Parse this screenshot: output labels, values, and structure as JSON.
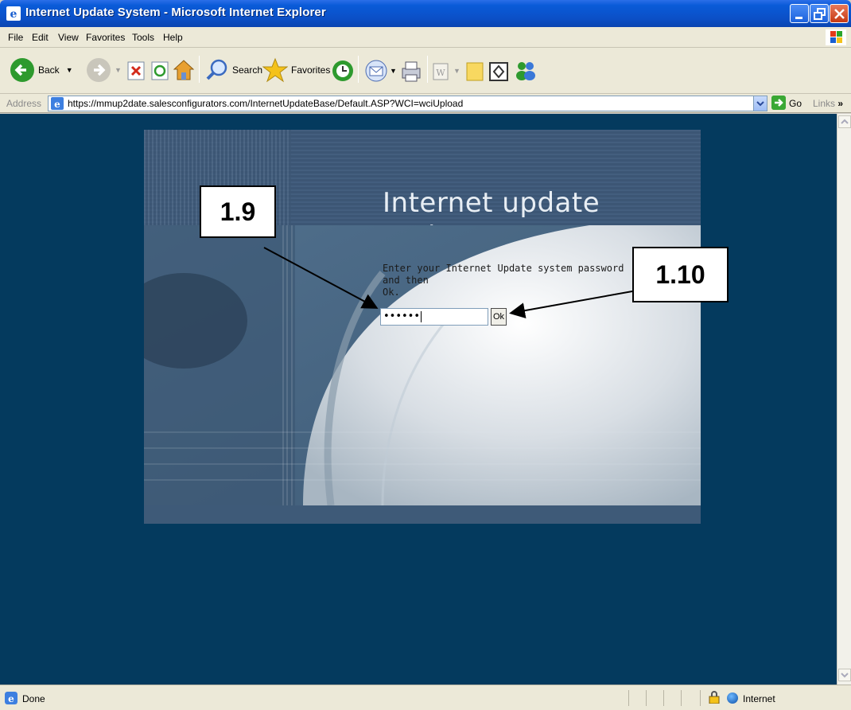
{
  "window": {
    "title": "Internet Update System - Microsoft Internet Explorer"
  },
  "menu": {
    "items": [
      "File",
      "Edit",
      "View",
      "Favorites",
      "Tools",
      "Help"
    ]
  },
  "toolbar": {
    "back": "Back",
    "search": "Search",
    "favorites": "Favorites"
  },
  "address": {
    "label": "Address",
    "url": "https://mmup2date.salesconfigurators.com/InternetUpdateBase/Default.ASP?WCI=wciUpload",
    "go": "Go",
    "links": "Links"
  },
  "page": {
    "header_title": "Internet update system",
    "instruction_line1": "Enter your Internet Update system password and then",
    "instruction_line2": "Ok.",
    "password_masked": "••••••",
    "ok_label": "Ok"
  },
  "callouts": {
    "password": "1.9",
    "ok": "1.10"
  },
  "status": {
    "text": "Done",
    "zone": "Internet"
  },
  "colors": {
    "page_background": "#043a5e",
    "titlebar": "#0a5bd8"
  }
}
